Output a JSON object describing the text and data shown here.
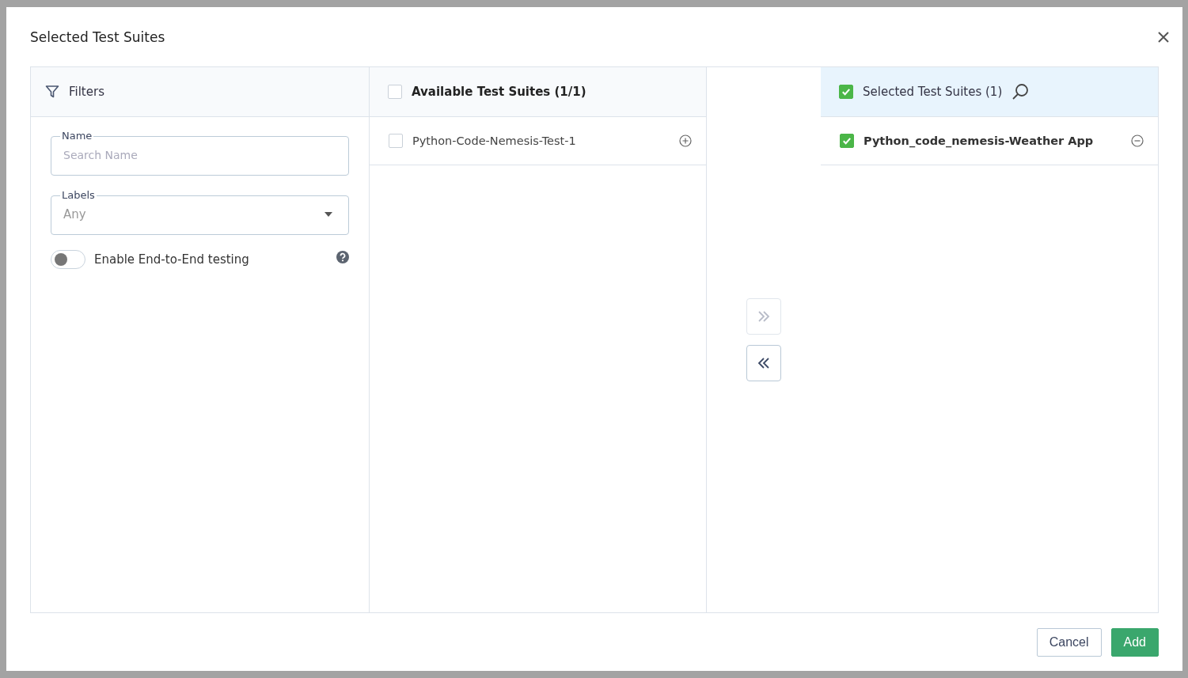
{
  "dialog": {
    "title": "Selected Test Suites"
  },
  "filters": {
    "heading": "Filters",
    "name_field": {
      "label": "Name",
      "placeholder": "Search Name"
    },
    "labels_field": {
      "label": "Labels",
      "value": "Any"
    },
    "toggle": {
      "label": "Enable End-to-End testing",
      "on": false
    }
  },
  "available": {
    "heading": "Available Test Suites (1/1)",
    "checked": false,
    "items": [
      {
        "name": "Python-Code-Nemesis-Test-1",
        "checked": false
      }
    ]
  },
  "transfer_buttons": [
    {
      "kind": "move_right",
      "disabled": true
    },
    {
      "kind": "move_left",
      "disabled": false
    }
  ],
  "selected": {
    "heading": "Selected Test Suites (1)",
    "checked": true,
    "items": [
      {
        "name": "Python_code_nemesis-Weather App",
        "checked": true
      }
    ]
  },
  "buttons": [
    {
      "label": "Cancel",
      "kind": "secondary"
    },
    {
      "label": "Add",
      "kind": "primary"
    }
  ]
}
